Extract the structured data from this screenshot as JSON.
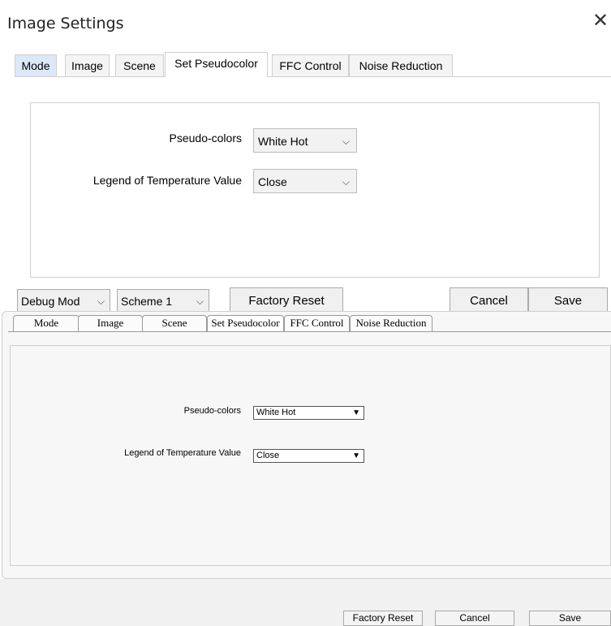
{
  "top": {
    "title": "Image Settings",
    "close_glyph": "✕",
    "tabs": [
      {
        "label": "Mode"
      },
      {
        "label": "Image"
      },
      {
        "label": "Scene"
      },
      {
        "label": "Set Pseudocolor"
      },
      {
        "label": "FFC Control"
      },
      {
        "label": "Noise Reduction"
      }
    ],
    "fields": {
      "pseudo_label": "Pseudo-colors",
      "pseudo_value": "White Hot",
      "legend_label": "Legend of Temperature Value",
      "legend_value": "Close"
    },
    "footer": {
      "debug_mode": "Debug Mod",
      "scheme": "Scheme 1",
      "factory_reset": "Factory Reset",
      "cancel": "Cancel",
      "save": "Save"
    },
    "chevron": "⌵"
  },
  "bottom": {
    "tabs": [
      {
        "label": "Mode"
      },
      {
        "label": "Image"
      },
      {
        "label": "Scene"
      },
      {
        "label": "Set Pseudocolor"
      },
      {
        "label": "FFC Control"
      },
      {
        "label": "Noise Reduction"
      }
    ],
    "fields": {
      "pseudo_label": "Pseudo-colors",
      "pseudo_value": "White Hot",
      "legend_label": "Legend of Temperature Value",
      "legend_value": "Close"
    },
    "footer": {
      "factory_reset": "Factory Reset",
      "cancel": "Cancel",
      "save": "Save"
    },
    "arrow": "▼"
  }
}
